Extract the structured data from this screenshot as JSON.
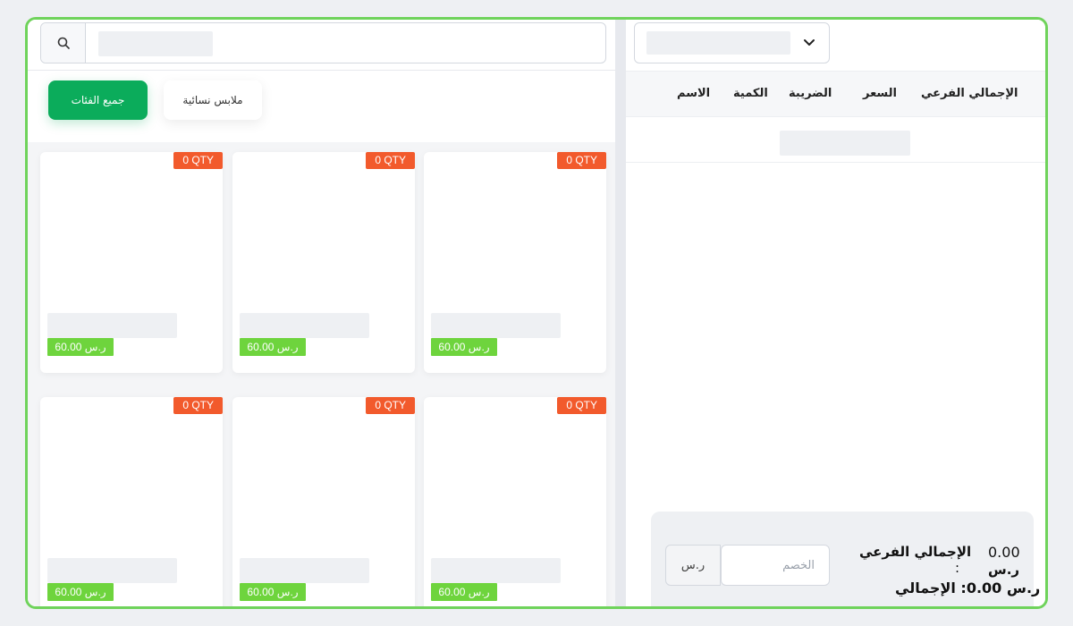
{
  "search": {
    "placeholder": ""
  },
  "categories": {
    "all_label": "جميع الفئات",
    "women_label": "ملابس نسائية"
  },
  "products": [
    {
      "qty": "0 QTY",
      "price": "60.00 ر.س"
    },
    {
      "qty": "0 QTY",
      "price": "60.00 ر.س"
    },
    {
      "qty": "0 QTY",
      "price": "60.00 ر.س"
    },
    {
      "qty": "0 QTY",
      "price": "60.00 ر.س"
    },
    {
      "qty": "0 QTY",
      "price": "60.00 ر.س"
    },
    {
      "qty": "0 QTY",
      "price": "60.00 ر.س"
    }
  ],
  "cart": {
    "columns": {
      "name": "الاسم",
      "qty": "الكمية",
      "tax": "الضريبة",
      "price": "السعر",
      "subtotal": "الإجمالي الفرعي"
    }
  },
  "summary": {
    "currency_button": "ر.س",
    "discount_placeholder": "الخصم",
    "subtotal_label": "الإجمالي الفرعي",
    "subtotal_value": "0.00",
    "colon": ":",
    "subtotal_currency": "ر.س",
    "total_line": "ر.س 0.00: الإجمالي"
  },
  "colors": {
    "frame_border": "#6fd35b",
    "category_active": "#0bac5b",
    "qty_badge": "#f25a2c",
    "price_badge": "#6ed43d"
  },
  "icons": {
    "search": "search-icon",
    "dropdown": "chevron-down-icon"
  }
}
